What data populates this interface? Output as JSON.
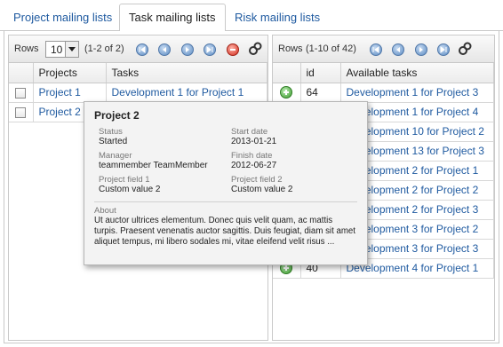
{
  "tabs": [
    {
      "label": "Project mailing lists",
      "active": false
    },
    {
      "label": "Task mailing lists",
      "active": true
    },
    {
      "label": "Risk mailing lists",
      "active": false
    }
  ],
  "left_panel": {
    "rows_label": "Rows",
    "rows_value": "10",
    "range": "(1-2 of 2)",
    "columns": [
      "",
      "Projects",
      "Tasks"
    ],
    "rows": [
      {
        "project": "Project 1",
        "task": "Development 1 for Project 1"
      },
      {
        "project": "Project 2",
        "task": ""
      }
    ]
  },
  "right_panel": {
    "rows_label": "Rows",
    "range": "(1-10 of 42)",
    "columns": [
      "",
      "id",
      "Available tasks"
    ],
    "rows": [
      {
        "id": "64",
        "task": "Development 1 for Project 3"
      },
      {
        "id": "",
        "task": "Development 1 for Project 4"
      },
      {
        "id": "",
        "task": "Development 10 for Project 2"
      },
      {
        "id": "",
        "task": "Development 13 for Project 3"
      },
      {
        "id": "",
        "task": "Development 2 for Project 1"
      },
      {
        "id": "",
        "task": "Development 2 for Project 2"
      },
      {
        "id": "",
        "task": "Development 2 for Project 3"
      },
      {
        "id": "",
        "task": "Development 3 for Project 2"
      },
      {
        "id": "",
        "task": "Development 3 for Project 3"
      },
      {
        "id": "40",
        "task": "Development 4 for Project 1"
      }
    ]
  },
  "tooltip": {
    "title": "Project 2",
    "status_label": "Status",
    "status_value": "Started",
    "start_label": "Start date",
    "start_value": "2013-01-21",
    "manager_label": "Manager",
    "manager_value": "teammember TeamMember",
    "finish_label": "Finish date",
    "finish_value": "2012-06-27",
    "field1_label": "Project field 1",
    "field1_value": "Custom value 2",
    "field2_label": "Project field 2",
    "field2_value": "Custom value 2",
    "about_label": "About",
    "about_value": "Ut auctor ultrices elementum. Donec quis velit quam, ac mattis turpis. Praesent venenatis auctor sagittis. Duis feugiat, diam sit amet aliquet tempus, mi libero sodales mi, vitae eleifend velit risus ..."
  },
  "colors": {
    "link": "#1f5aa0",
    "border": "#c9c9c9"
  }
}
